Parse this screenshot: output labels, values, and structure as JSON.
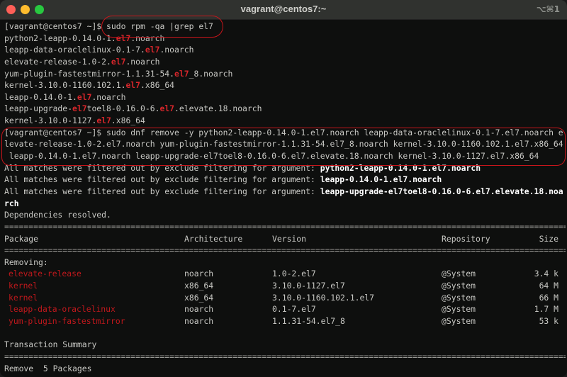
{
  "window": {
    "title": "vagrant@centos7:~",
    "shortcut": "⌥⌘1"
  },
  "colors": {
    "accent_red": "#d8262b",
    "highlight": "#c8151b"
  },
  "rpm_query": {
    "prompt": "[vagrant@centos7 ~]$ ",
    "command": "sudo rpm -qa |grep el7",
    "output": [
      [
        {
          "t": "python2-leapp-0.14.0-1."
        },
        {
          "t": "el7",
          "r": 1
        },
        {
          "t": ".noarch"
        }
      ],
      [
        {
          "t": "leapp-data-oraclelinux-0.1-7."
        },
        {
          "t": "el7",
          "r": 1
        },
        {
          "t": ".noarch"
        }
      ],
      [
        {
          "t": "elevate-release-1.0-2."
        },
        {
          "t": "el7",
          "r": 1
        },
        {
          "t": ".noarch"
        }
      ],
      [
        {
          "t": "yum-plugin-fastestmirror-1.1.31-54."
        },
        {
          "t": "el7",
          "r": 1
        },
        {
          "t": "_8.noarch"
        }
      ],
      [
        {
          "t": "kernel-3.10.0-1160.102.1."
        },
        {
          "t": "el7",
          "r": 1
        },
        {
          "t": ".x86_64"
        }
      ],
      [
        {
          "t": "leapp-0.14.0-1."
        },
        {
          "t": "el7",
          "r": 1
        },
        {
          "t": ".noarch"
        }
      ],
      [
        {
          "t": "leapp-upgrade-"
        },
        {
          "t": "el7",
          "r": 1
        },
        {
          "t": "toel8-0.16.0-6."
        },
        {
          "t": "el7",
          "r": 1
        },
        {
          "t": ".elevate.18.noarch"
        }
      ],
      [
        {
          "t": "kernel-3.10.0-1127."
        },
        {
          "t": "el7",
          "r": 1
        },
        {
          "t": ".x86_64"
        }
      ]
    ]
  },
  "dnf_remove": {
    "command_lines": [
      "[vagrant@centos7 ~]$ sudo dnf remove -y python2-leapp-0.14.0-1.el7.noarch leapp-data-oraclelinux-0.1-7.el7.noarch e",
      "levate-release-1.0-2.el7.noarch yum-plugin-fastestmirror-1.1.31-54.el7_8.noarch kernel-3.10.0-1160.102.1.el7.x86_64",
      " leapp-0.14.0-1.el7.noarch leapp-upgrade-el7toel8-0.16.0-6.el7.elevate.18.noarch kernel-3.10.0-1127.el7.x86_64"
    ],
    "filter_prefix": "All matches were filtered out by exclude filtering for argument: ",
    "filtered": [
      "python2-leapp-0.14.0-1.el7.noarch",
      "leapp-0.14.0-1.el7.noarch",
      "leapp-upgrade-el7toel8-0.16.0-6.el7.elevate.18.noa"
    ],
    "filtered_wrap": "rch",
    "deps": "Dependencies resolved.",
    "separator_char": "=",
    "headers": {
      "package": "Package",
      "arch": "Architecture",
      "version": "Version",
      "repo": "Repository",
      "size": "Size"
    },
    "section": "Removing:",
    "rows": [
      {
        "package": "elevate-release",
        "arch": "noarch",
        "version": "1.0-2.el7",
        "repo": "@System",
        "size": "3.4 k"
      },
      {
        "package": "kernel",
        "arch": "x86_64",
        "version": "3.10.0-1127.el7",
        "repo": "@System",
        "size": "64 M"
      },
      {
        "package": "kernel",
        "arch": "x86_64",
        "version": "3.10.0-1160.102.1.el7",
        "repo": "@System",
        "size": "66 M"
      },
      {
        "package": "leapp-data-oraclelinux",
        "arch": "noarch",
        "version": "0.1-7.el7",
        "repo": "@System",
        "size": "1.7 M"
      },
      {
        "package": "yum-plugin-fastestmirror",
        "arch": "noarch",
        "version": "1.1.31-54.el7_8",
        "repo": "@System",
        "size": "53 k"
      }
    ],
    "summary_title": "Transaction Summary",
    "summary": "Remove  5 Packages"
  }
}
